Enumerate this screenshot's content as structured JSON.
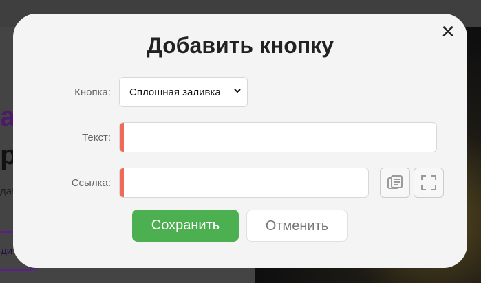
{
  "background": {
    "heading_accent": "а",
    "heading": "р,",
    "text": "да!",
    "button_label": "ди"
  },
  "modal": {
    "title": "Добавить кнопку",
    "close_icon": "close-icon",
    "fields": {
      "button_type": {
        "label": "Кнопка:",
        "selected": "Сплошная заливка",
        "options": [
          "Сплошная заливка"
        ]
      },
      "text": {
        "label": "Текст:",
        "value": ""
      },
      "link": {
        "label": "Ссылка:",
        "value": ""
      }
    },
    "link_actions": {
      "paste_icon": "paste-icon",
      "fullscreen_icon": "fullscreen-icon"
    },
    "actions": {
      "save_label": "Сохранить",
      "cancel_label": "Отменить"
    }
  },
  "colors": {
    "save": "#4caf50",
    "required_marker": "#f06a5a",
    "modal_bg": "#f4f4f4",
    "overlay": "#3f3f3f",
    "accent": "#5b1f86"
  }
}
